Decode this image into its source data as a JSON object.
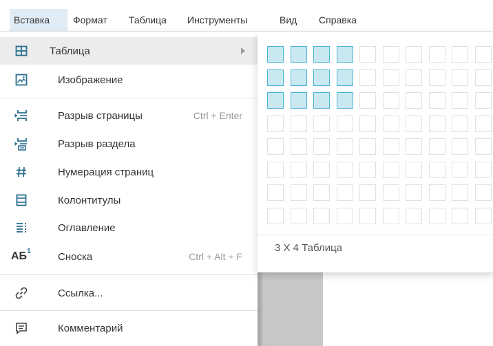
{
  "menubar": {
    "items": [
      "Вставка",
      "Формат",
      "Таблица",
      "Инструменты",
      "Вид",
      "Справка"
    ]
  },
  "insert_menu": {
    "items": [
      {
        "label": "Таблица",
        "icon": "table-icon",
        "has_submenu": true
      },
      {
        "label": "Изображение",
        "icon": "image-icon"
      },
      {
        "label": "Разрыв страницы",
        "icon": "page-break-icon",
        "shortcut": "Ctrl + Enter"
      },
      {
        "label": "Разрыв раздела",
        "icon": "section-break-icon"
      },
      {
        "label": "Нумерация страниц",
        "icon": "hash-icon"
      },
      {
        "label": "Колонтитулы",
        "icon": "header-footer-icon"
      },
      {
        "label": "Оглавление",
        "icon": "toc-icon"
      },
      {
        "label": "Сноска",
        "icon": "footnote-icon",
        "shortcut": "Ctrl + Alt + F"
      },
      {
        "label": "Ссылка...",
        "icon": "link-icon"
      },
      {
        "label": "Комментарий",
        "icon": "comment-icon"
      }
    ],
    "footnote_icon_text": "АБ",
    "footnote_icon_sup": "1"
  },
  "table_picker": {
    "columns": 10,
    "rows": 8,
    "selected_columns": 4,
    "selected_rows": 3,
    "size_label": "3 X 4 Таблица"
  },
  "colors": {
    "accent_icon": "#2b7fa3",
    "selected_cell": "#c9e8f0",
    "selected_border": "#4ab4d6",
    "active_menu_bg": "#e0ecf6"
  }
}
